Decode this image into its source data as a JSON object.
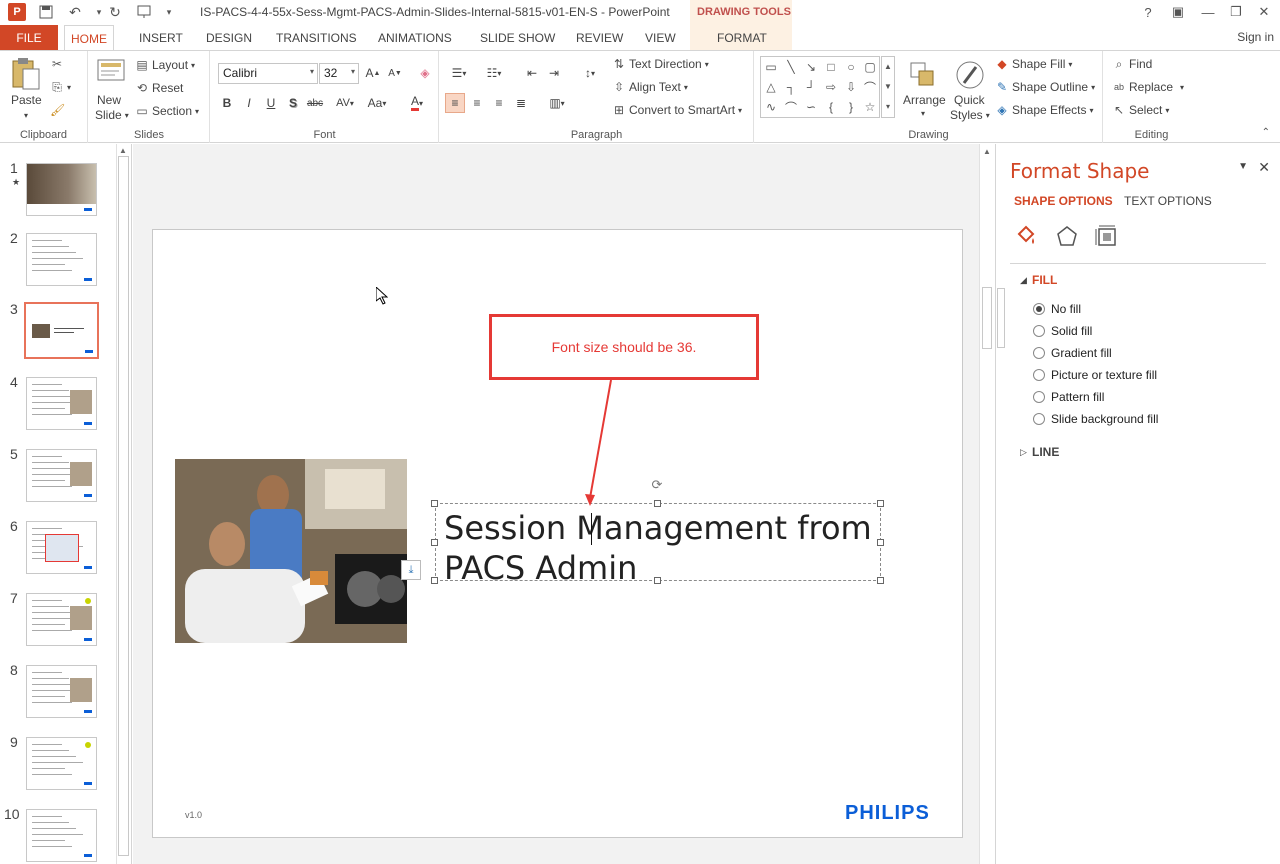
{
  "titlebar": {
    "document_title": "IS-PACS-4-4-55x-Sess-Mgmt-PACS-Admin-Slides-Internal-5815-v01-EN-S - PowerPoint",
    "contextual_label": "DRAWING TOOLS"
  },
  "tabs": {
    "file": "FILE",
    "items": [
      "HOME",
      "INSERT",
      "DESIGN",
      "TRANSITIONS",
      "ANIMATIONS",
      "SLIDE SHOW",
      "REVIEW",
      "VIEW"
    ],
    "format": "FORMAT",
    "signin": "Sign in"
  },
  "ribbon": {
    "clipboard": {
      "label": "Clipboard",
      "paste": "Paste"
    },
    "slides": {
      "label": "Slides",
      "new_slide_line1": "New",
      "new_slide_line2": "Slide",
      "layout": "Layout",
      "reset": "Reset",
      "section": "Section"
    },
    "font": {
      "label": "Font",
      "font_name": "Calibri",
      "font_size": "32",
      "bold": "B",
      "italic": "I",
      "underline": "U",
      "shadow": "S",
      "strike": "abc",
      "spacing": "AV",
      "case": "Aa",
      "color": "A"
    },
    "paragraph": {
      "label": "Paragraph",
      "text_direction": "Text Direction",
      "align_text": "Align Text",
      "convert_smartart": "Convert to SmartArt"
    },
    "drawing": {
      "label": "Drawing",
      "arrange": "Arrange",
      "quick_styles_1": "Quick",
      "quick_styles_2": "Styles",
      "shape_fill": "Shape Fill",
      "shape_outline": "Shape Outline",
      "shape_effects": "Shape Effects"
    },
    "editing": {
      "label": "Editing",
      "find": "Find",
      "replace": "Replace",
      "select": "Select"
    }
  },
  "thumbnails": [
    {
      "num": "1",
      "star": "★"
    },
    {
      "num": "2"
    },
    {
      "num": "3"
    },
    {
      "num": "4"
    },
    {
      "num": "5"
    },
    {
      "num": "6"
    },
    {
      "num": "7"
    },
    {
      "num": "8"
    },
    {
      "num": "9"
    },
    {
      "num": "10"
    }
  ],
  "selected_slide": 3,
  "slide": {
    "callout_text": "Font size should be 36.",
    "title_line1": "Session Management from",
    "title_line2": "PACS Admin",
    "version": "v1.0",
    "logo": "PHILIPS"
  },
  "format_pane": {
    "title": "Format Shape",
    "tab_shape": "SHAPE OPTIONS",
    "tab_text": "TEXT OPTIONS",
    "fill_header": "FILL",
    "fill_options": [
      "No fill",
      "Solid fill",
      "Gradient fill",
      "Picture or texture fill",
      "Pattern fill",
      "Slide background fill"
    ],
    "selected_fill": "No fill",
    "line_header": "LINE"
  },
  "colors": {
    "accent": "#d24726",
    "callout": "#e53935",
    "philips_blue": "#0b5ed7"
  }
}
